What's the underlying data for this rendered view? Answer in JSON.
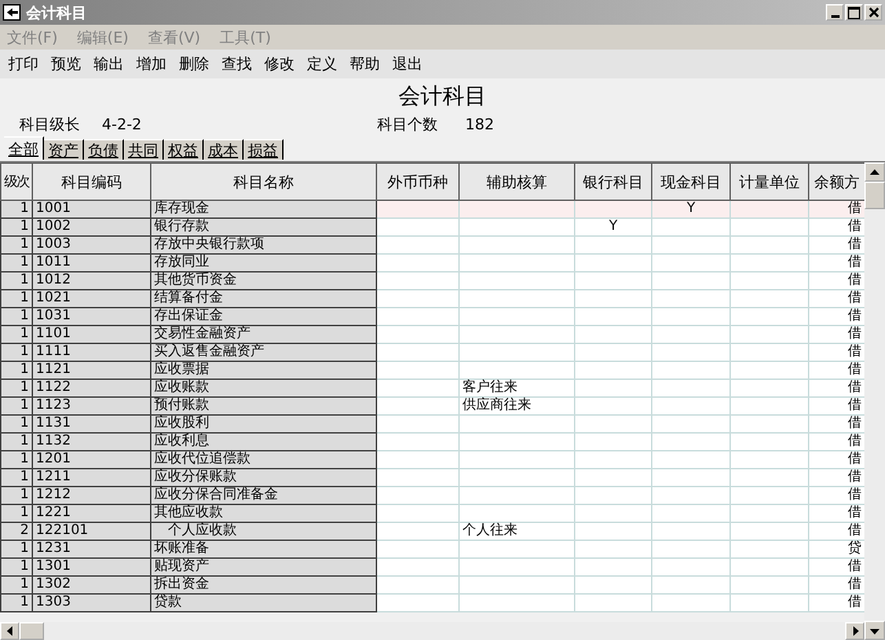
{
  "window": {
    "title": "会计科目"
  },
  "menu": [
    "文件(F)",
    "编辑(E)",
    "查看(V)",
    "工具(T)"
  ],
  "toolbar": [
    "打印",
    "预览",
    "输出",
    "增加",
    "删除",
    "查找",
    "修改",
    "定义",
    "帮助",
    "退出"
  ],
  "heading": "会计科目",
  "info": {
    "code_length_label": "科目级长",
    "code_length": "4-2-2",
    "count_label": "科目个数",
    "count": "182"
  },
  "tabs": [
    {
      "label": "全部",
      "selected": true
    },
    {
      "label": "资产",
      "selected": false
    },
    {
      "label": "负债",
      "selected": false
    },
    {
      "label": "共同",
      "selected": false
    },
    {
      "label": "权益",
      "selected": false
    },
    {
      "label": "成本",
      "selected": false
    },
    {
      "label": "损益",
      "selected": false
    }
  ],
  "table": {
    "columns": [
      "级次",
      "科目编码",
      "科目名称",
      "外币币种",
      "辅助核算",
      "银行科目",
      "现金科目",
      "计量单位",
      "余额方"
    ],
    "rows": [
      {
        "level": "1",
        "code": "1001",
        "name": "库存现金",
        "aux": "",
        "bank": "",
        "cash": "Y",
        "direction": "借",
        "selected": true
      },
      {
        "level": "1",
        "code": "1002",
        "name": "银行存款",
        "aux": "",
        "bank": "Y",
        "cash": "",
        "direction": "借",
        "selected": false
      },
      {
        "level": "1",
        "code": "1003",
        "name": "存放中央银行款项",
        "aux": "",
        "bank": "",
        "cash": "",
        "direction": "借",
        "selected": false
      },
      {
        "level": "1",
        "code": "1011",
        "name": "存放同业",
        "aux": "",
        "bank": "",
        "cash": "",
        "direction": "借",
        "selected": false
      },
      {
        "level": "1",
        "code": "1012",
        "name": "其他货币资金",
        "aux": "",
        "bank": "",
        "cash": "",
        "direction": "借",
        "selected": false
      },
      {
        "level": "1",
        "code": "1021",
        "name": "结算备付金",
        "aux": "",
        "bank": "",
        "cash": "",
        "direction": "借",
        "selected": false
      },
      {
        "level": "1",
        "code": "1031",
        "name": "存出保证金",
        "aux": "",
        "bank": "",
        "cash": "",
        "direction": "借",
        "selected": false
      },
      {
        "level": "1",
        "code": "1101",
        "name": "交易性金融资产",
        "aux": "",
        "bank": "",
        "cash": "",
        "direction": "借",
        "selected": false
      },
      {
        "level": "1",
        "code": "1111",
        "name": "买入返售金融资产",
        "aux": "",
        "bank": "",
        "cash": "",
        "direction": "借",
        "selected": false
      },
      {
        "level": "1",
        "code": "1121",
        "name": "应收票据",
        "aux": "",
        "bank": "",
        "cash": "",
        "direction": "借",
        "selected": false
      },
      {
        "level": "1",
        "code": "1122",
        "name": "应收账款",
        "aux": "客户往来",
        "bank": "",
        "cash": "",
        "direction": "借",
        "selected": false
      },
      {
        "level": "1",
        "code": "1123",
        "name": "预付账款",
        "aux": "供应商往来",
        "bank": "",
        "cash": "",
        "direction": "借",
        "selected": false
      },
      {
        "level": "1",
        "code": "1131",
        "name": "应收股利",
        "aux": "",
        "bank": "",
        "cash": "",
        "direction": "借",
        "selected": false
      },
      {
        "level": "1",
        "code": "1132",
        "name": "应收利息",
        "aux": "",
        "bank": "",
        "cash": "",
        "direction": "借",
        "selected": false
      },
      {
        "level": "1",
        "code": "1201",
        "name": "应收代位追偿款",
        "aux": "",
        "bank": "",
        "cash": "",
        "direction": "借",
        "selected": false
      },
      {
        "level": "1",
        "code": "1211",
        "name": "应收分保账款",
        "aux": "",
        "bank": "",
        "cash": "",
        "direction": "借",
        "selected": false
      },
      {
        "level": "1",
        "code": "1212",
        "name": "应收分保合同准备金",
        "aux": "",
        "bank": "",
        "cash": "",
        "direction": "借",
        "selected": false
      },
      {
        "level": "1",
        "code": "1221",
        "name": "其他应收款",
        "aux": "",
        "bank": "",
        "cash": "",
        "direction": "借",
        "selected": false
      },
      {
        "level": "2",
        "code": "122101",
        "name": "个人应收款",
        "aux": "个人往来",
        "bank": "",
        "cash": "",
        "direction": "借",
        "selected": false
      },
      {
        "level": "1",
        "code": "1231",
        "name": "坏账准备",
        "aux": "",
        "bank": "",
        "cash": "",
        "direction": "贷",
        "selected": false
      },
      {
        "level": "1",
        "code": "1301",
        "name": "贴现资产",
        "aux": "",
        "bank": "",
        "cash": "",
        "direction": "借",
        "selected": false
      },
      {
        "level": "1",
        "code": "1302",
        "name": "拆出资金",
        "aux": "",
        "bank": "",
        "cash": "",
        "direction": "借",
        "selected": false
      },
      {
        "level": "1",
        "code": "1303",
        "name": "贷款",
        "aux": "",
        "bank": "",
        "cash": "",
        "direction": "借",
        "selected": false
      }
    ]
  }
}
